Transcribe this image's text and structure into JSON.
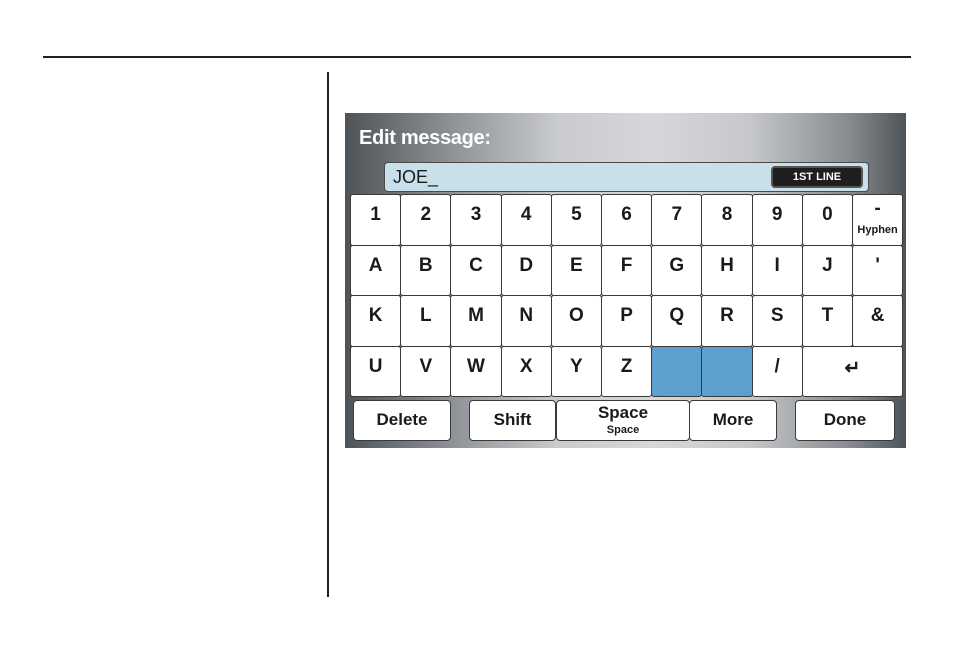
{
  "screen": {
    "title": "Edit message:",
    "entry": {
      "value": "JOE_",
      "line_button": "1ST LINE"
    },
    "keyboard": {
      "rows": [
        [
          {
            "main": "1"
          },
          {
            "main": "2"
          },
          {
            "main": "3"
          },
          {
            "main": "4"
          },
          {
            "main": "5"
          },
          {
            "main": "6"
          },
          {
            "main": "7"
          },
          {
            "main": "8"
          },
          {
            "main": "9"
          },
          {
            "main": "0"
          },
          {
            "main": "-",
            "sub": "Hyphen"
          }
        ],
        [
          {
            "main": "A"
          },
          {
            "main": "B"
          },
          {
            "main": "C"
          },
          {
            "main": "D"
          },
          {
            "main": "E"
          },
          {
            "main": "F"
          },
          {
            "main": "G"
          },
          {
            "main": "H"
          },
          {
            "main": "I"
          },
          {
            "main": "J"
          },
          {
            "main": "'"
          }
        ],
        [
          {
            "main": "K"
          },
          {
            "main": "L"
          },
          {
            "main": "M"
          },
          {
            "main": "N"
          },
          {
            "main": "O"
          },
          {
            "main": "P"
          },
          {
            "main": "Q"
          },
          {
            "main": "R"
          },
          {
            "main": "S"
          },
          {
            "main": "T"
          },
          {
            "main": "&"
          }
        ],
        [
          {
            "main": "U"
          },
          {
            "main": "V"
          },
          {
            "main": "W"
          },
          {
            "main": "X"
          },
          {
            "main": "Y"
          },
          {
            "main": "Z"
          },
          {
            "main": "",
            "blank": true
          },
          {
            "main": "",
            "blank": true
          },
          {
            "main": "/"
          },
          {
            "main": "↵",
            "enter": true
          }
        ]
      ]
    },
    "buttons": {
      "delete": "Delete",
      "shift": "Shift",
      "space": "Space",
      "space_sub": "Space",
      "more": "More",
      "done": "Done"
    },
    "colors": {
      "entry_bg": "#c9e0ea",
      "blank_key": "#5ba0cf",
      "line_button_bg": "#1e1e1e"
    }
  }
}
